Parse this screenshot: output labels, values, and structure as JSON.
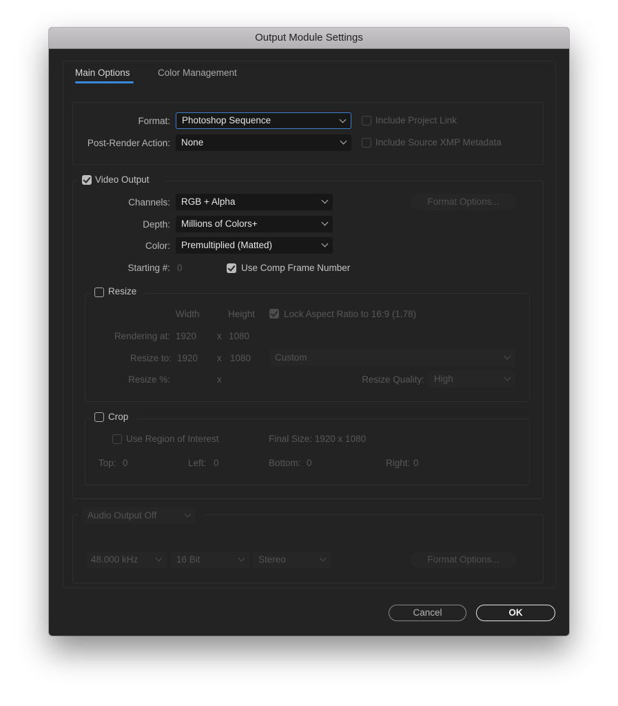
{
  "window": {
    "title": "Output Module Settings"
  },
  "tabs": [
    {
      "label": "Main Options",
      "active": true
    },
    {
      "label": "Color Management",
      "active": false
    }
  ],
  "format_section": {
    "format_label": "Format:",
    "format_value": "Photoshop Sequence",
    "post_render_label": "Post-Render Action:",
    "post_render_value": "None",
    "include_project_link": {
      "label": "Include Project Link",
      "checked": false,
      "enabled": false
    },
    "include_xmp": {
      "label": "Include Source XMP Metadata",
      "checked": false,
      "enabled": false
    }
  },
  "video_output": {
    "label": "Video Output",
    "checked": true,
    "channels_label": "Channels:",
    "channels_value": "RGB + Alpha",
    "depth_label": "Depth:",
    "depth_value": "Millions of Colors+",
    "color_label": "Color:",
    "color_value": "Premultiplied (Matted)",
    "starting_label": "Starting #:",
    "starting_value": "0",
    "use_comp_frame": {
      "label": "Use Comp Frame Number",
      "checked": true
    },
    "format_options_label": "Format Options..."
  },
  "resize": {
    "label": "Resize",
    "checked": false,
    "width_header": "Width",
    "height_header": "Height",
    "lock_aspect": {
      "label": "Lock Aspect Ratio to 16:9 (1.78)",
      "checked": true
    },
    "rendering_at_label": "Rendering at:",
    "rendering_width": "1920",
    "rendering_height": "1080",
    "resize_to_label": "Resize to:",
    "resize_width": "1920",
    "resize_height": "1080",
    "preset_value": "Custom",
    "resize_pct_label": "Resize %:",
    "x_sep": "x",
    "quality_label": "Resize Quality:",
    "quality_value": "High"
  },
  "crop": {
    "label": "Crop",
    "checked": false,
    "use_roi": {
      "label": "Use Region of Interest",
      "checked": false
    },
    "final_size": "Final Size: 1920 x 1080",
    "top_label": "Top:",
    "top_value": "0",
    "left_label": "Left:",
    "left_value": "0",
    "bottom_label": "Bottom:",
    "bottom_value": "0",
    "right_label": "Right:",
    "right_value": "0"
  },
  "audio": {
    "mode_value": "Audio Output Off",
    "rate_value": "48.000 kHz",
    "bits_value": "16 Bit",
    "channels_value": "Stereo",
    "format_options_label": "Format Options..."
  },
  "buttons": {
    "cancel": "Cancel",
    "ok": "OK"
  }
}
